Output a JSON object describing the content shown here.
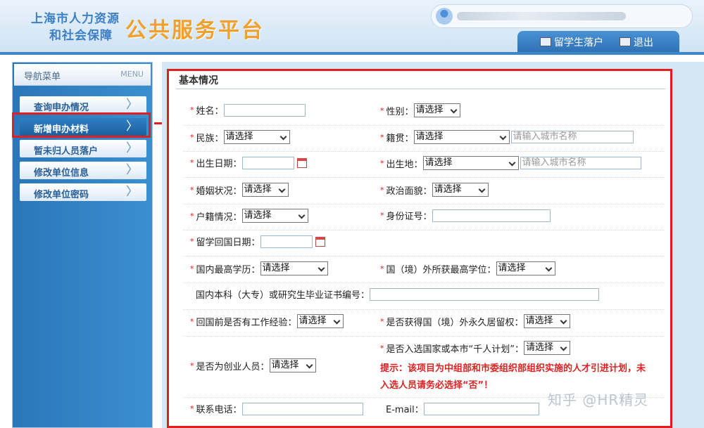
{
  "header": {
    "logo_line1": "上海市人力资源",
    "logo_line2": "和社会保障",
    "platform_title": "公共服务平台",
    "tabs": [
      {
        "label": "留学生落户",
        "icon": "document-icon"
      },
      {
        "label": "退出",
        "icon": "exit-icon"
      }
    ]
  },
  "sidebar": {
    "title": "导航菜单",
    "title_en": "MENU",
    "items": [
      {
        "label": "查询申办情况",
        "active": false
      },
      {
        "label": "新增申办材料",
        "active": true
      },
      {
        "label": "暂未归人员落户",
        "active": false
      },
      {
        "label": "修改单位信息",
        "active": false
      },
      {
        "label": "修改单位密码",
        "active": false
      }
    ]
  },
  "form": {
    "section_title": "基本情况",
    "name_label": "姓名：",
    "gender_label": "性别：",
    "gender_value": "请选择",
    "ethnicity_label": "民族：",
    "ethnicity_value": "请选择",
    "native_label": "籍贯：",
    "native_value": "请选择",
    "native_city_placeholder": "请输入城市名称",
    "birthdate_label": "出生日期：",
    "birthplace_label": "出生地：",
    "birthplace_value": "请选择",
    "birthplace_city_placeholder": "请输入城市名称",
    "marital_label": "婚姻状况：",
    "marital_value": "请选择",
    "political_label": "政治面貌：",
    "political_value": "请选择",
    "household_label": "户籍情况：",
    "household_value": "请选择",
    "idcard_label": "身份证号：",
    "return_date_label": "留学回国日期：",
    "domestic_edu_label": "国内最高学历：",
    "domestic_edu_value": "请选择",
    "foreign_degree_label": "国（境）外所获最高学位：",
    "foreign_degree_value": "请选择",
    "cert_label": "国内本科（大专）或研究生毕业证书编号：",
    "work_exp_label": "回国前是否有工作经验：",
    "work_exp_value": "请选择",
    "residence_label": "是否获得国（境）外永久居留权：",
    "residence_value": "请选择",
    "thousand_label": "是否入选国家或本市“千人计划”：",
    "thousand_value": "请选择",
    "entrepreneur_label": "是否为创业人员：",
    "entrepreneur_value": "请选择",
    "hint": "提示：该项目为中组部和市委组织部组织实施的人才引进计划，未入选人员请务必选择“否”！",
    "phone_label": "联系电话：",
    "email_label": "E-mail："
  },
  "watermark": "知乎 @HR精灵"
}
